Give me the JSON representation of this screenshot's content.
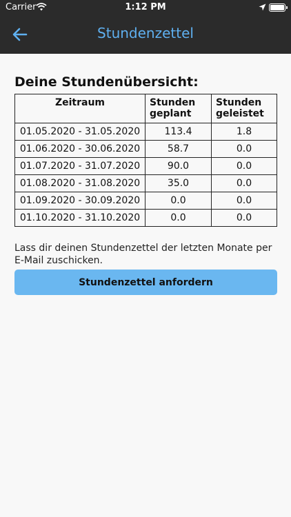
{
  "status_bar": {
    "carrier": "Carrier",
    "time": "1:12 PM"
  },
  "nav": {
    "title": "Stundenzettel",
    "title_color": "#5fb0f0"
  },
  "overview": {
    "heading": "Deine Stundenübersicht:",
    "columns": [
      "Zeitraum",
      "Stunden geplant",
      "Stunden geleistet"
    ],
    "rows": [
      {
        "period": "01.05.2020 - 31.05.2020",
        "planned": "113.4",
        "done": "1.8"
      },
      {
        "period": "01.06.2020 - 30.06.2020",
        "planned": "58.7",
        "done": "0.0"
      },
      {
        "period": "01.07.2020 - 31.07.2020",
        "planned": "90.0",
        "done": "0.0"
      },
      {
        "period": "01.08.2020 - 31.08.2020",
        "planned": "35.0",
        "done": "0.0"
      },
      {
        "period": "01.09.2020 - 30.09.2020",
        "planned": "0.0",
        "done": "0.0"
      },
      {
        "period": "01.10.2020 - 31.10.2020",
        "planned": "0.0",
        "done": "0.0"
      }
    ]
  },
  "info_text": "Lass dir deinen Stundenzettel der letzten Monate per E-Mail zuschicken.",
  "request_button": {
    "label": "Stundenzettel anfordern",
    "color": "#6ab7f0"
  },
  "icons": {
    "back": "arrow-left-icon",
    "wifi": "wifi-icon",
    "location": "location-arrow-icon",
    "battery": "battery-icon"
  }
}
